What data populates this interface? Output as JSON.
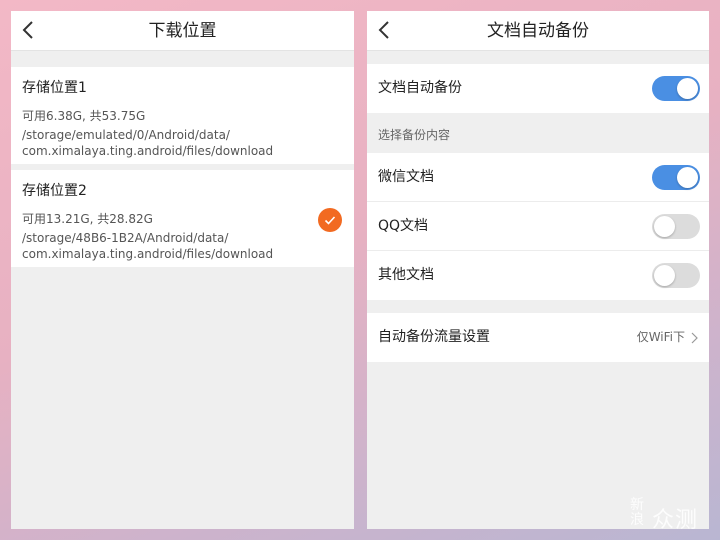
{
  "left": {
    "title": "下载位置",
    "items": [
      {
        "name": "存储位置1",
        "free": "可用6.38G, 共53.75G",
        "path_line1": "/storage/emulated/0/Android/data/",
        "path_line2": "com.ximalaya.ting.android/files/download",
        "selected": false
      },
      {
        "name": "存储位置2",
        "free": "可用13.21G, 共28.82G",
        "path_line1": "/storage/48B6-1B2A/Android/data/",
        "path_line2": "com.ximalaya.ting.android/files/download",
        "selected": true
      }
    ],
    "accent_color": "#f26a21"
  },
  "right": {
    "title": "文档自动备份",
    "auto_backup": {
      "label": "文档自动备份",
      "on": true
    },
    "section_header": "选择备份内容",
    "options": [
      {
        "label": "微信文档",
        "on": true
      },
      {
        "label": "QQ文档",
        "on": false
      },
      {
        "label": "其他文档",
        "on": false
      }
    ],
    "traffic": {
      "label": "自动备份流量设置",
      "value": "仅WiFi下"
    },
    "toggle_on_color": "#4a8fe3",
    "toggle_off_color": "#dcdcdc"
  },
  "watermark": {
    "small": "新浪",
    "big": "众测"
  }
}
